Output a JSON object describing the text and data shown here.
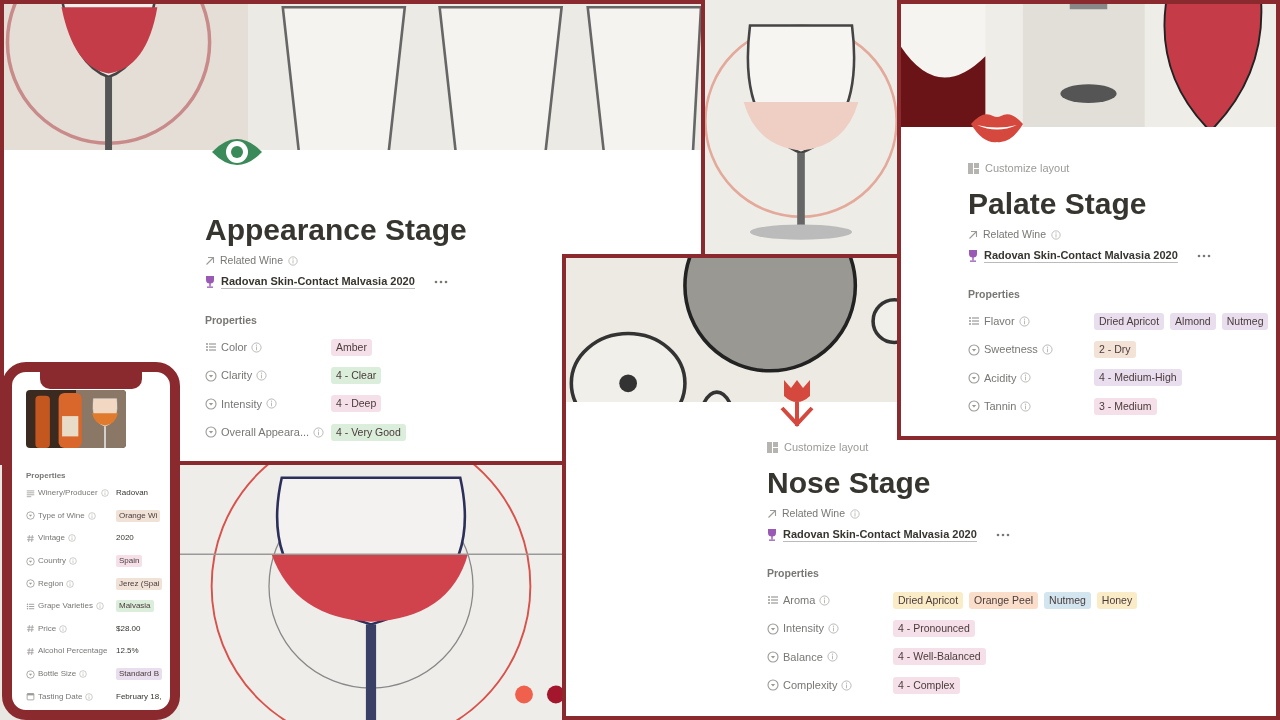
{
  "pages": [
    {
      "title": "Appearance Stage",
      "related_label": "Related Wine",
      "related_wine": "Radovan Skin-Contact Malvasia 2020",
      "properties_heading": "Properties",
      "properties": [
        {
          "kind": "list",
          "label": "Color",
          "tags": [
            {
              "text": "Amber",
              "color": "#f5e0e9"
            }
          ]
        },
        {
          "kind": "select",
          "label": "Clarity",
          "tags": [
            {
              "text": "4 - Clear",
              "color": "#dbeddb"
            }
          ]
        },
        {
          "kind": "select",
          "label": "Intensity",
          "tags": [
            {
              "text": "4 - Deep",
              "color": "#f5e0e9"
            }
          ]
        },
        {
          "kind": "select",
          "label": "Overall Appeara...",
          "tags": [
            {
              "text": "4 - Very Good",
              "color": "#dbeddb"
            }
          ]
        }
      ]
    },
    {
      "customize": "Customize layout",
      "title": "Palate Stage",
      "related_label": "Related Wine",
      "related_wine": "Radovan Skin-Contact Malvasia 2020",
      "properties_heading": "Properties",
      "properties": [
        {
          "kind": "list",
          "label": "Flavor",
          "tags": [
            {
              "text": "Dried Apricot",
              "color": "#e8deee"
            },
            {
              "text": "Almond",
              "color": "#e8deee"
            },
            {
              "text": "Nutmeg",
              "color": "#e8deee"
            }
          ]
        },
        {
          "kind": "select",
          "label": "Sweetness",
          "tags": [
            {
              "text": "2 - Dry",
              "color": "#f3e2d6"
            }
          ]
        },
        {
          "kind": "select",
          "label": "Acidity",
          "tags": [
            {
              "text": "4 - Medium-High",
              "color": "#e8deee"
            }
          ]
        },
        {
          "kind": "select",
          "label": "Tannin",
          "tags": [
            {
              "text": "3 - Medium",
              "color": "#f5e0e9"
            }
          ]
        }
      ]
    },
    {
      "customize": "Customize layout",
      "title": "Nose Stage",
      "related_label": "Related Wine",
      "related_wine": "Radovan Skin-Contact Malvasia 2020",
      "properties_heading": "Properties",
      "properties": [
        {
          "kind": "list",
          "label": "Aroma",
          "tags": [
            {
              "text": "Dried Apricot",
              "color": "#fbecc8"
            },
            {
              "text": "Orange Peel",
              "color": "#fadec9"
            },
            {
              "text": "Nutmeg",
              "color": "#d3e5ef"
            },
            {
              "text": "Honey",
              "color": "#fbecc8"
            }
          ]
        },
        {
          "kind": "select",
          "label": "Intensity",
          "tags": [
            {
              "text": "4 - Pronounced",
              "color": "#f5e0e9"
            }
          ]
        },
        {
          "kind": "select",
          "label": "Balance",
          "tags": [
            {
              "text": "4 - Well-Balanced",
              "color": "#f5e0e9"
            }
          ]
        },
        {
          "kind": "select",
          "label": "Complexity",
          "tags": [
            {
              "text": "4 - Complex",
              "color": "#f5e0e9"
            }
          ]
        }
      ]
    }
  ],
  "phone": {
    "properties_heading": "Properties",
    "properties": [
      {
        "kind": "text",
        "label": "Winery/Producer",
        "value": "Radovan"
      },
      {
        "kind": "select",
        "label": "Type of Wine",
        "tags": [
          {
            "text": "Orange Wi",
            "color": "#f1e2d8"
          }
        ]
      },
      {
        "kind": "number",
        "label": "Vintage",
        "value": "2020"
      },
      {
        "kind": "select",
        "label": "Country",
        "tags": [
          {
            "text": "Spain",
            "color": "#f5e0e9"
          }
        ]
      },
      {
        "kind": "select",
        "label": "Region",
        "tags": [
          {
            "text": "Jerez (Spai",
            "color": "#f1e2d8"
          }
        ]
      },
      {
        "kind": "list",
        "label": "Grape Varieties",
        "tags": [
          {
            "text": "Malvasia",
            "color": "#dbeddb"
          }
        ]
      },
      {
        "kind": "number",
        "label": "Price",
        "value": "$28.00"
      },
      {
        "kind": "number",
        "label": "Alcohol Percentage",
        "value": "12.5%",
        "no_info": true
      },
      {
        "kind": "select",
        "label": "Bottle Size",
        "tags": [
          {
            "text": "Standard B",
            "color": "#e8deee"
          }
        ]
      },
      {
        "kind": "date",
        "label": "Tasting Date",
        "value": "February 18,"
      }
    ]
  }
}
